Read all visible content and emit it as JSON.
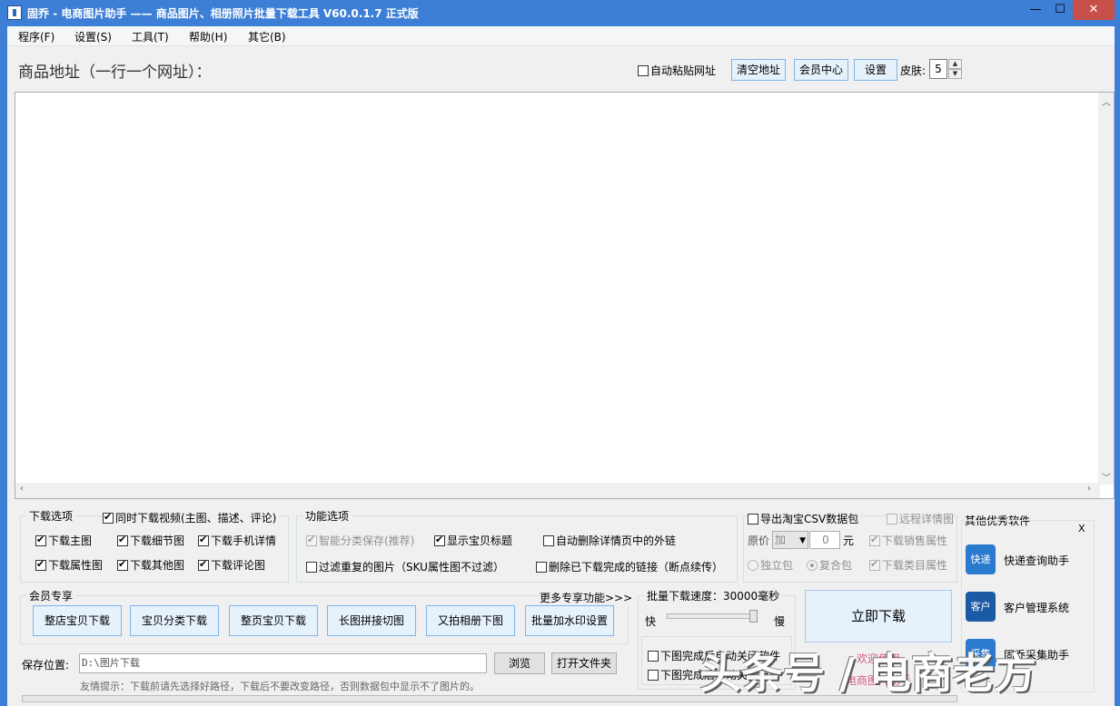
{
  "window": {
    "title": "固乔 - 电商图片助手 —— 商品图片、相册照片批量下载工具 V60.0.1.7 正式版",
    "min": "—",
    "max": "☐",
    "close": "✕"
  },
  "menu": [
    "程序(F)",
    "设置(S)",
    "工具(T)",
    "帮助(H)",
    "其它(B)"
  ],
  "header": {
    "label": "商品地址（一行一个网址）：",
    "auto_paste": "自动粘贴网址",
    "clear_btn": "清空地址",
    "member_btn": "会员中心",
    "settings_btn": "设置",
    "skin_label": "皮肤:",
    "skin_value": "5"
  },
  "download_options": {
    "title": "下载选项",
    "sync_video": "同时下载视频(主图、描述、评论)",
    "main_img": "下载主图",
    "detail_img": "下载细节图",
    "mobile_detail": "下载手机详情",
    "attr_img": "下载属性图",
    "other_img": "下载其他图",
    "review_img": "下载评论图"
  },
  "function_options": {
    "title": "功能选项",
    "smart_save": "智能分类保存(推荐)",
    "show_title": "显示宝贝标题",
    "auto_delete_links": "自动删除详情页中的外链",
    "filter_dup": "过滤重复的图片（SKU属性图不过滤）",
    "delete_done": "删除已下载完成的链接（断点续传）"
  },
  "csv": {
    "export": "导出淘宝CSV数据包",
    "remote_detail": "远程详情图",
    "price_label": "原价",
    "price_op": "加",
    "price_value": "0",
    "yuan": "元",
    "sales_attr": "下载销售属性",
    "standalone": "独立包",
    "composite": "复合包",
    "category_attr": "下载类目属性"
  },
  "member": {
    "title": "会员专享",
    "more": "更多专享功能>>>",
    "buttons": [
      "整店宝贝下载",
      "宝贝分类下载",
      "整页宝贝下载",
      "长图拼接切图",
      "又拍相册下图",
      "批量加水印设置"
    ]
  },
  "speed": {
    "title": "批量下载速度：30000毫秒",
    "fast": "快",
    "slow": "慢",
    "close_after": "下图完成后自动关闭软件",
    "shutdown_after": "下图完成后自动关闭电脑"
  },
  "download_btn": "立即下载",
  "welcome": [
    "欢迎使用",
    "电商图片助手"
  ],
  "save": {
    "label": "保存位置:",
    "path": "D:\\图片下载",
    "browse": "浏览",
    "open_folder": "打开文件夹",
    "tip": "友情提示：下载前请先选择好路径，下载后不要改变路径，否则数据包中显示不了图片的。"
  },
  "other_software": {
    "title": "其他优秀软件",
    "close": "X",
    "items": [
      {
        "label": "快递查询助手",
        "icon": "快递"
      },
      {
        "label": "客户管理系统",
        "icon": "客户"
      },
      {
        "label": "固乔采集助手",
        "icon": "采集"
      }
    ]
  },
  "watermark": "头条号 / 电商老方"
}
